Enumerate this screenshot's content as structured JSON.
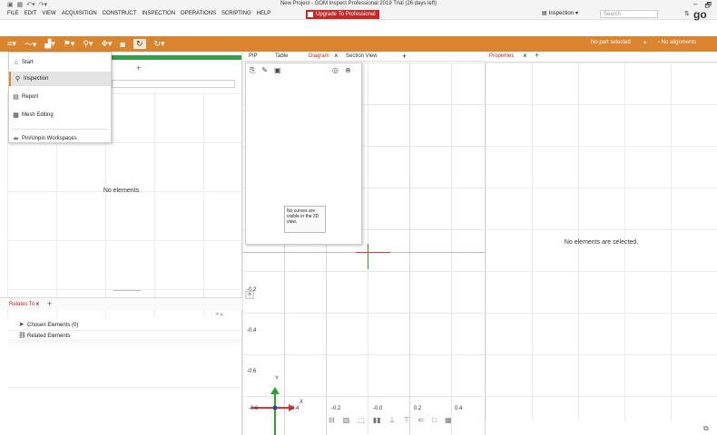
{
  "window": {
    "title": "New Project - GOM Inspect Professional 2019 Trial (26 days left)",
    "minimize": "–",
    "maximize": "🗗"
  },
  "menubar": {
    "items": [
      "FILE",
      "EDIT",
      "VIEW",
      "ACQUISITION",
      "CONSTRUCT",
      "INSPECTION",
      "OPERATIONS",
      "SCRIPTING",
      "HELP"
    ],
    "upgrade_label": "Upgrade To Professional",
    "workspace_label": "Inspection",
    "workspace_caret": "▾",
    "search_placeholder": "Search",
    "logo": "go"
  },
  "toolbar": {
    "part_status": "No part selected",
    "plus": "+",
    "alignment_status": "▫ No alignments"
  },
  "workspace_menu": {
    "items": [
      {
        "label": "Start",
        "icon": "home-icon"
      },
      {
        "label": "Inspection",
        "icon": "magnifier-icon"
      },
      {
        "label": "Report",
        "icon": "report-icon"
      },
      {
        "label": "Mesh Editing",
        "icon": "grid-icon"
      },
      {
        "label": "Pin/Unpin Workspaces",
        "icon": "pin-icon"
      }
    ],
    "selected_index": 1
  },
  "explorer": {
    "tab_plus": "+",
    "empty_message": "No elements"
  },
  "relates_to": {
    "tab_label": "Relates To",
    "close": "×",
    "add": "+",
    "arrows": "▿  ▵",
    "chosen_label": "Chosen Elements (0)",
    "related_label": "Related Elements"
  },
  "view_tabs": {
    "tabs": [
      "PIP",
      "Table",
      "Diagram",
      "Section View"
    ],
    "active": "Diagram",
    "close": "×",
    "add": "+"
  },
  "diagram": {
    "note": "No curves are visible in the 3D view."
  },
  "view3d": {
    "y_labels": [
      "-0.2",
      "-0.4",
      "-0.6"
    ],
    "x_labels": [
      "-0.6",
      "-0.4",
      "-0.2",
      "-0.0",
      "0.2",
      "0.4"
    ],
    "axis_x": "X",
    "axis_y": "Y",
    "collapse": "«"
  },
  "properties": {
    "tab_label": "Properties",
    "close": "×",
    "add": "+",
    "empty_message": "No elements are selected."
  }
}
